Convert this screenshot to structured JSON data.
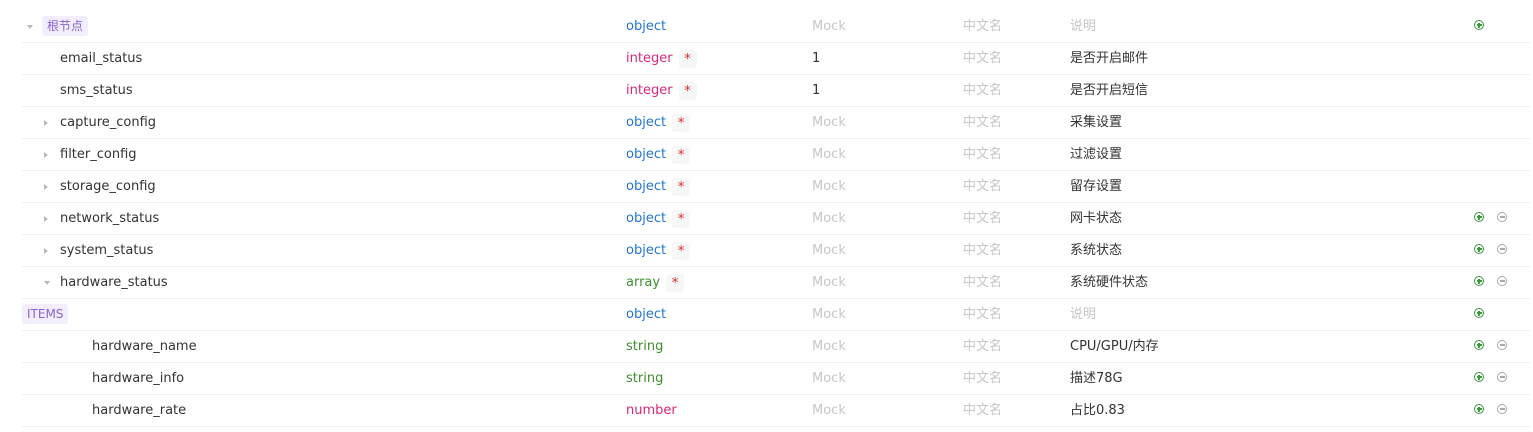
{
  "rows": [
    {
      "name": "根节点",
      "type": "object",
      "required": false,
      "mock": "Mock",
      "title": "中文名",
      "description": "说明",
      "description_placeholder": true,
      "caret": "down",
      "tag": true,
      "add": true,
      "remove": false
    },
    {
      "name": "email_status",
      "type": "integer",
      "required": true,
      "mock": "1",
      "title": "中文名",
      "description": "是否开启邮件",
      "caret": "none",
      "tag": false,
      "add": false,
      "remove": false
    },
    {
      "name": "sms_status",
      "type": "integer",
      "required": true,
      "mock": "1",
      "title": "中文名",
      "description": "是否开启短信",
      "caret": "none",
      "tag": false,
      "add": false,
      "remove": false
    },
    {
      "name": "capture_config",
      "type": "object",
      "required": true,
      "mock": "Mock",
      "title": "中文名",
      "description": "采集设置",
      "caret": "right",
      "tag": false,
      "add": false,
      "remove": false
    },
    {
      "name": "filter_config",
      "type": "object",
      "required": true,
      "mock": "Mock",
      "title": "中文名",
      "description": "过滤设置",
      "caret": "right",
      "tag": false,
      "add": false,
      "remove": false
    },
    {
      "name": "storage_config",
      "type": "object",
      "required": true,
      "mock": "Mock",
      "title": "中文名",
      "description": "留存设置",
      "caret": "right",
      "tag": false,
      "add": false,
      "remove": false
    },
    {
      "name": "network_status",
      "type": "object",
      "required": true,
      "mock": "Mock",
      "title": "中文名",
      "description": "网卡状态",
      "caret": "right",
      "tag": false,
      "add": true,
      "remove": true
    },
    {
      "name": "system_status",
      "type": "object",
      "required": true,
      "mock": "Mock",
      "title": "中文名",
      "description": "系统状态",
      "caret": "right",
      "tag": false,
      "add": true,
      "remove": true
    },
    {
      "name": "hardware_status",
      "type": "array",
      "required": true,
      "mock": "Mock",
      "title": "中文名",
      "description": "系统硬件状态",
      "caret": "down",
      "tag": false,
      "add": true,
      "remove": true
    },
    {
      "name": "ITEMS",
      "type": "object",
      "required": false,
      "mock": "Mock",
      "title": "中文名",
      "description": "说明",
      "description_placeholder": true,
      "caret": "down",
      "tag": true,
      "add": true,
      "remove": false
    },
    {
      "name": "hardware_name",
      "type": "string",
      "required": false,
      "mock": "Mock",
      "title": "中文名",
      "description": "CPU/GPU/内存",
      "caret": "none",
      "tag": false,
      "add": true,
      "remove": true
    },
    {
      "name": "hardware_info",
      "type": "string",
      "required": false,
      "mock": "Mock",
      "title": "中文名",
      "description": "描述78G",
      "caret": "none",
      "tag": false,
      "add": true,
      "remove": true
    },
    {
      "name": "hardware_rate",
      "type": "number",
      "required": false,
      "mock": "Mock",
      "title": "中文名",
      "description": "占比0.83",
      "caret": "none",
      "tag": false,
      "add": true,
      "remove": true
    }
  ],
  "required_mark": "*",
  "colors": {
    "object": "#1f76d2",
    "integer": "#d6287b",
    "number": "#d6287b",
    "array": "#3d8f2d",
    "string": "#3d8f2d",
    "tag_bg": "#f3eefc",
    "tag_text": "#8a62d9",
    "add_icon": "#3a9b3a",
    "remove_icon": "#a6a6a6",
    "required": "#e02424"
  }
}
